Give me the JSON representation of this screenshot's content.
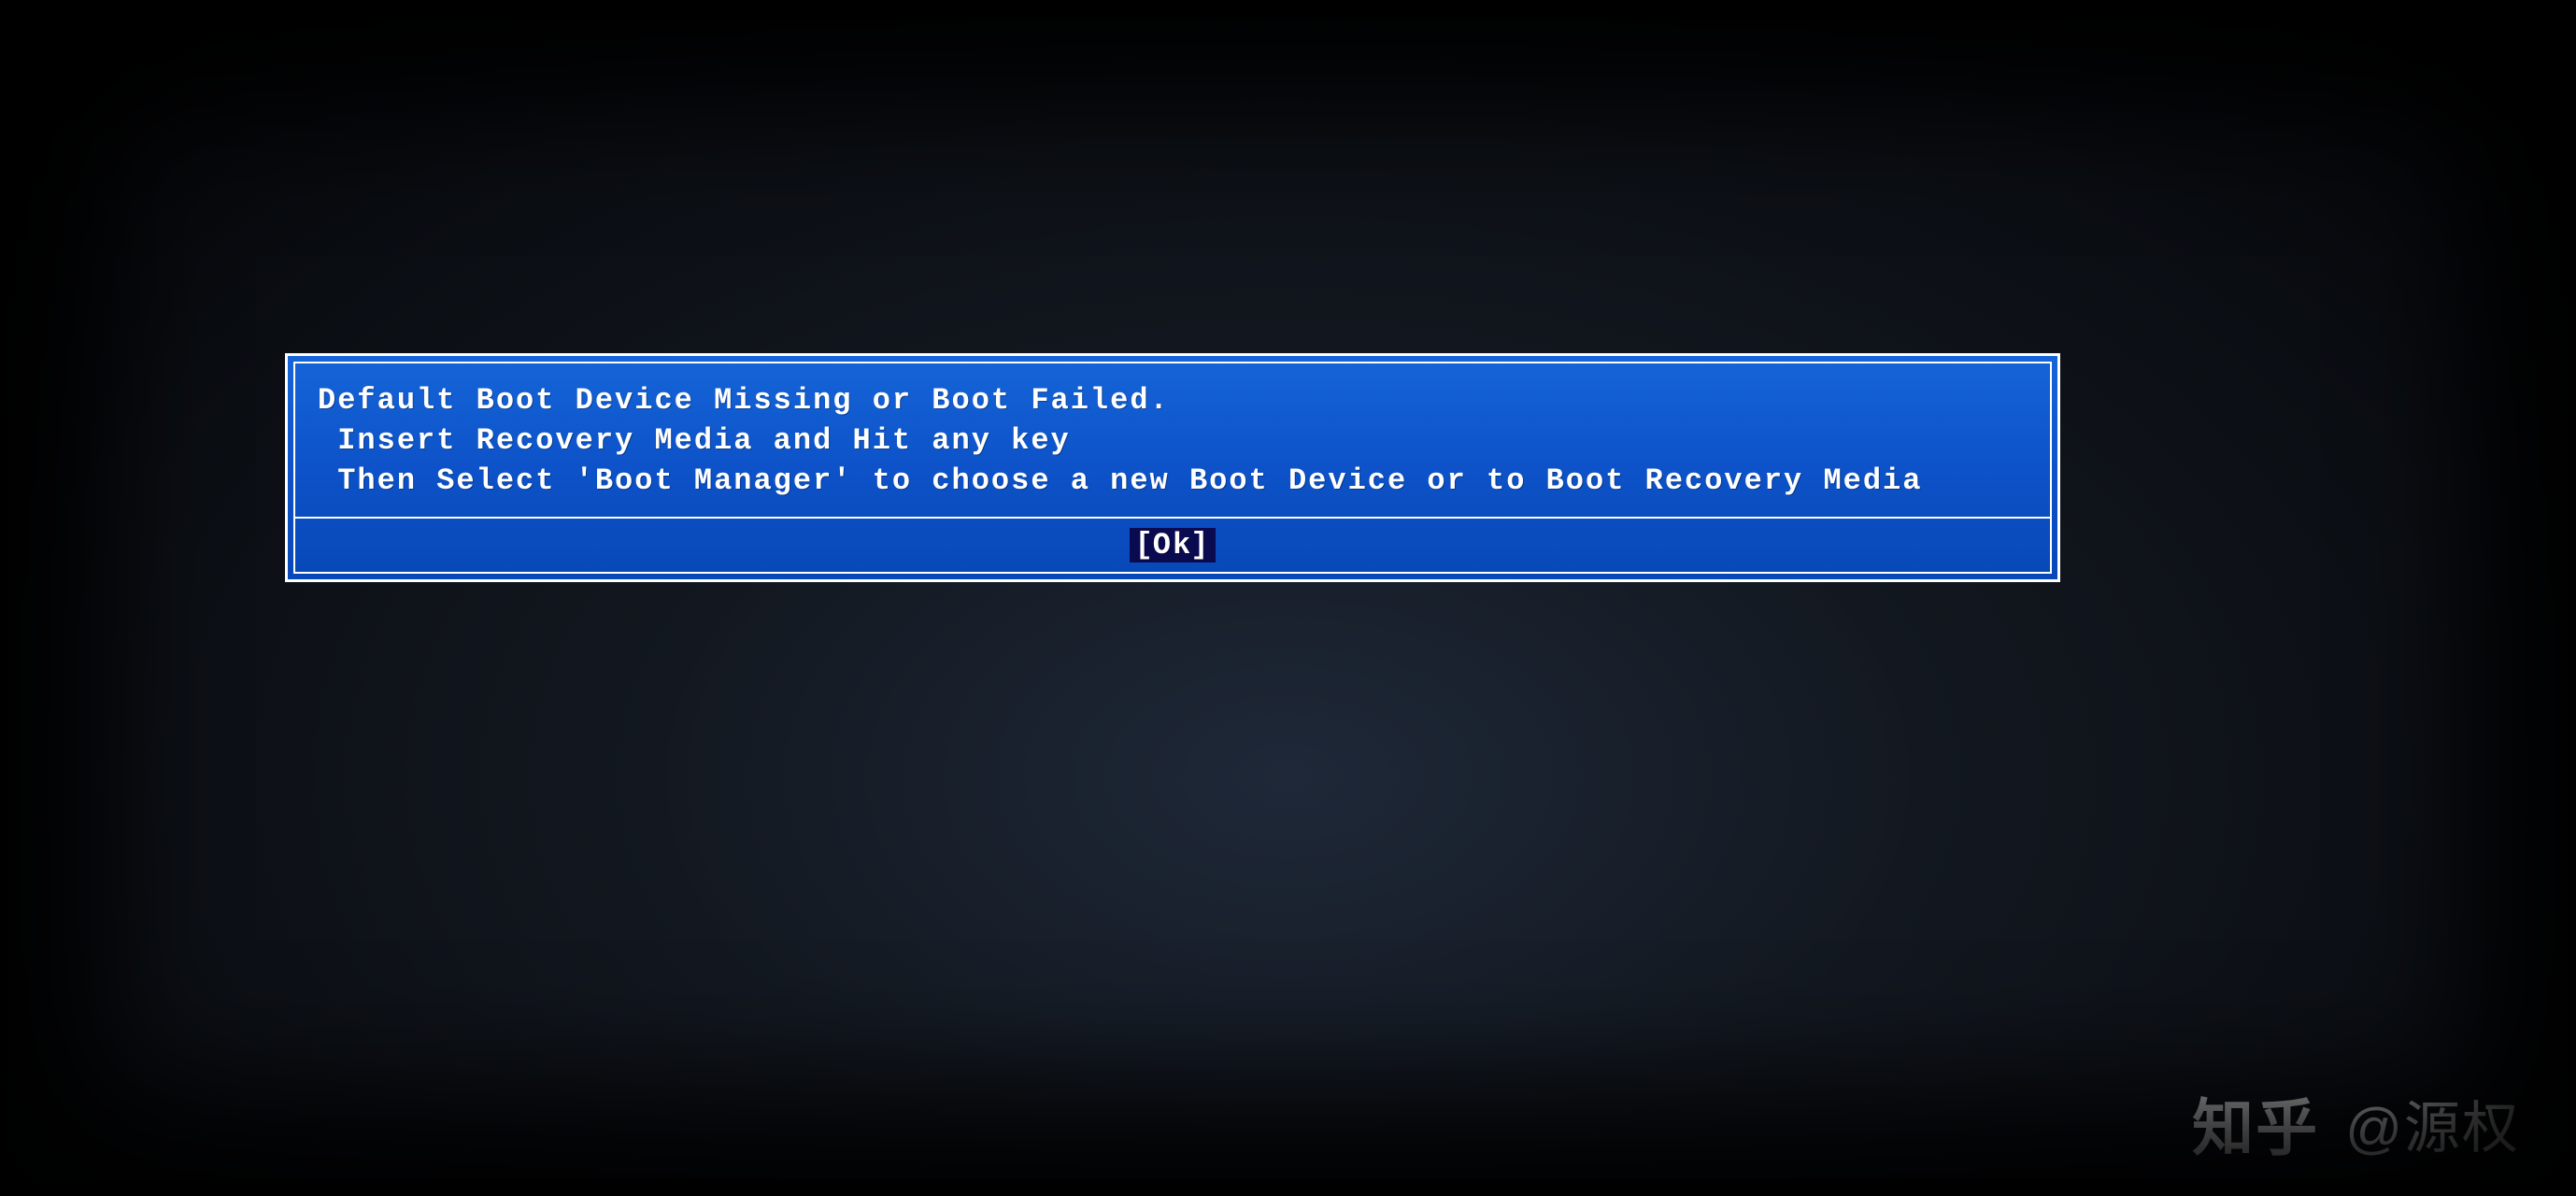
{
  "dialog": {
    "line1": "Default Boot Device Missing or Boot Failed.",
    "line2": " Insert Recovery Media and Hit any key",
    "line3": " Then Select 'Boot Manager' to choose a new Boot Device or to Boot Recovery Media",
    "ok_label": "Ok"
  },
  "watermark": {
    "site": "知乎",
    "author": "@源权"
  }
}
